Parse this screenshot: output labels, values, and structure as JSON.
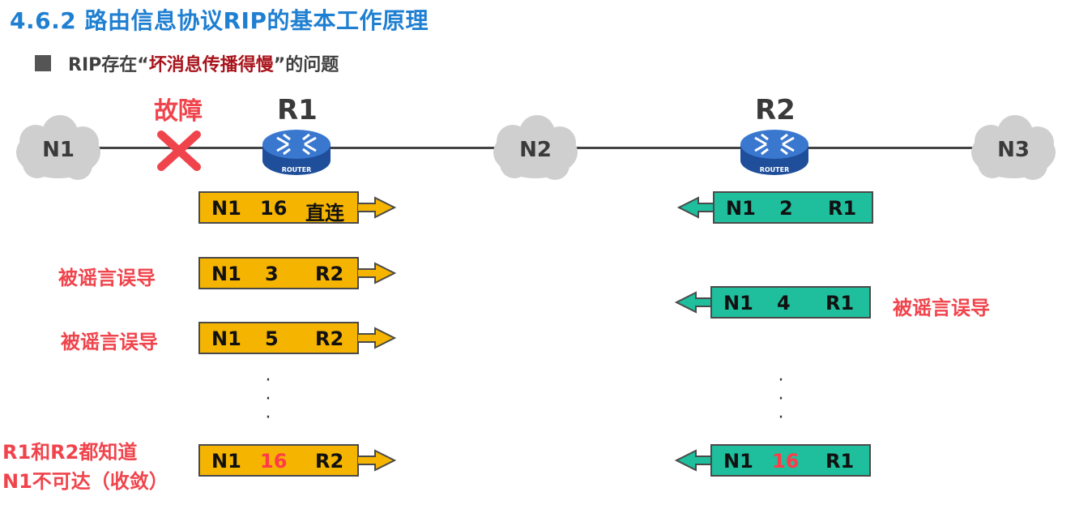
{
  "title": "4.6.2 路由信息协议RIP的基本工作原理",
  "subtitle": {
    "prefix": "RIP存在“",
    "highlight": "坏消息传播得慢",
    "suffix": "”的问题"
  },
  "networks": [
    "N1",
    "N2",
    "N3"
  ],
  "routers": [
    {
      "label": "R1",
      "badge": "ROUTER"
    },
    {
      "label": "R2",
      "badge": "ROUTER"
    }
  ],
  "fault_label": "故障",
  "r1_entries": [
    {
      "dest": "N1",
      "dist": "16",
      "next": "直连"
    },
    {
      "dest": "N1",
      "dist": "3",
      "next": "R2"
    },
    {
      "dest": "N1",
      "dist": "5",
      "next": "R2"
    },
    {
      "dest": "N1",
      "dist": "16",
      "next": "R2"
    }
  ],
  "r2_entries": [
    {
      "dest": "N1",
      "dist": "2",
      "next": "R1"
    },
    {
      "dest": "N1",
      "dist": "4",
      "next": "R1"
    },
    {
      "dest": "N1",
      "dist": "16",
      "next": "R1"
    }
  ],
  "annotations": {
    "misled": "被谣言误导",
    "converge_line1": "R1和R2都知道",
    "converge_line2": "N1不可达（收敛）"
  },
  "colors": {
    "title": "#1f7fd1",
    "r1_box": "#f5b400",
    "r2_box": "#1fbf9d",
    "alert": "#f0444c",
    "highlight": "#a8141c"
  }
}
